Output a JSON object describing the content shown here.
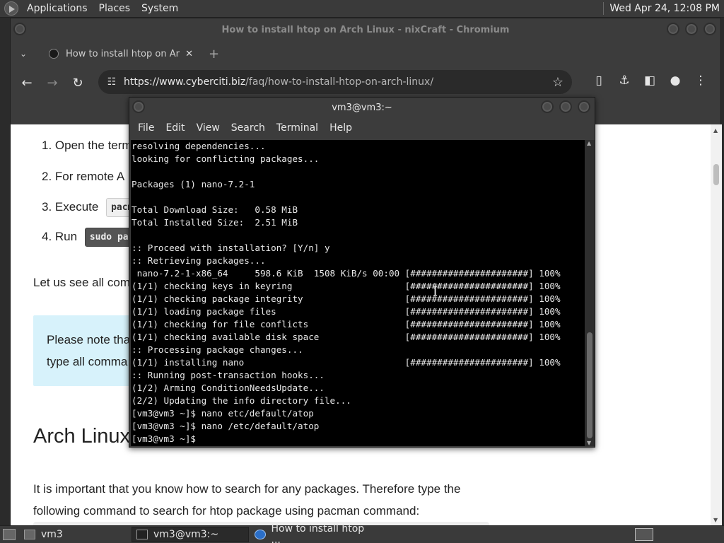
{
  "top_panel": {
    "menus": [
      "Applications",
      "Places",
      "System"
    ],
    "clock": "Wed Apr 24, 12:08 PM"
  },
  "browser": {
    "window_title": "How to install htop on Arch Linux - nixCraft - Chromium",
    "tab_title": "How to install htop on Arch L",
    "url_host": "https://www.cyberciti.biz",
    "url_path": "/faq/how-to-install-htop-on-arch-linux/"
  },
  "page": {
    "step1": "1. Open the term",
    "step2": "2. For remote A",
    "step3": "3. Execute",
    "step3_code": "pacm",
    "step4": "4. Run",
    "step4_code": "sudo pa",
    "intro": "Let us see all com",
    "note_line1": "Please note tha",
    "note_line2": "type all comma",
    "heading": "Arch Linux",
    "para_line1": "It is important that you know how to search for any packages. Therefore type the",
    "para_line2": "following command to search for htop package using pacman command:"
  },
  "terminal": {
    "title": "vm3@vm3:~",
    "menus": [
      "File",
      "Edit",
      "View",
      "Search",
      "Terminal",
      "Help"
    ],
    "output": "resolving dependencies...\nlooking for conflicting packages...\n\nPackages (1) nano-7.2-1\n\nTotal Download Size:   0.58 MiB\nTotal Installed Size:  2.51 MiB\n\n:: Proceed with installation? [Y/n] y\n:: Retrieving packages...\n nano-7.2-1-x86_64     598.6 KiB  1508 KiB/s 00:00 [######################] 100%\n(1/1) checking keys in keyring                     [######################] 100%\n(1/1) checking package integrity                   [######################] 100%\n(1/1) loading package files                        [######################] 100%\n(1/1) checking for file conflicts                  [######################] 100%\n(1/1) checking available disk space                [######################] 100%\n:: Processing package changes...\n(1/1) installing nano                              [######################] 100%\n:: Running post-transaction hooks...\n(1/2) Arming ConditionNeedsUpdate...\n(2/2) Updating the info directory file...\n[vm3@vm3 ~]$ nano etc/default/atop\n[vm3@vm3 ~]$ nano /etc/default/atop\n[vm3@vm3 ~]$ "
  },
  "taskbar": {
    "items": [
      "vm3",
      "vm3@vm3:~",
      "How to install htop ..."
    ]
  }
}
